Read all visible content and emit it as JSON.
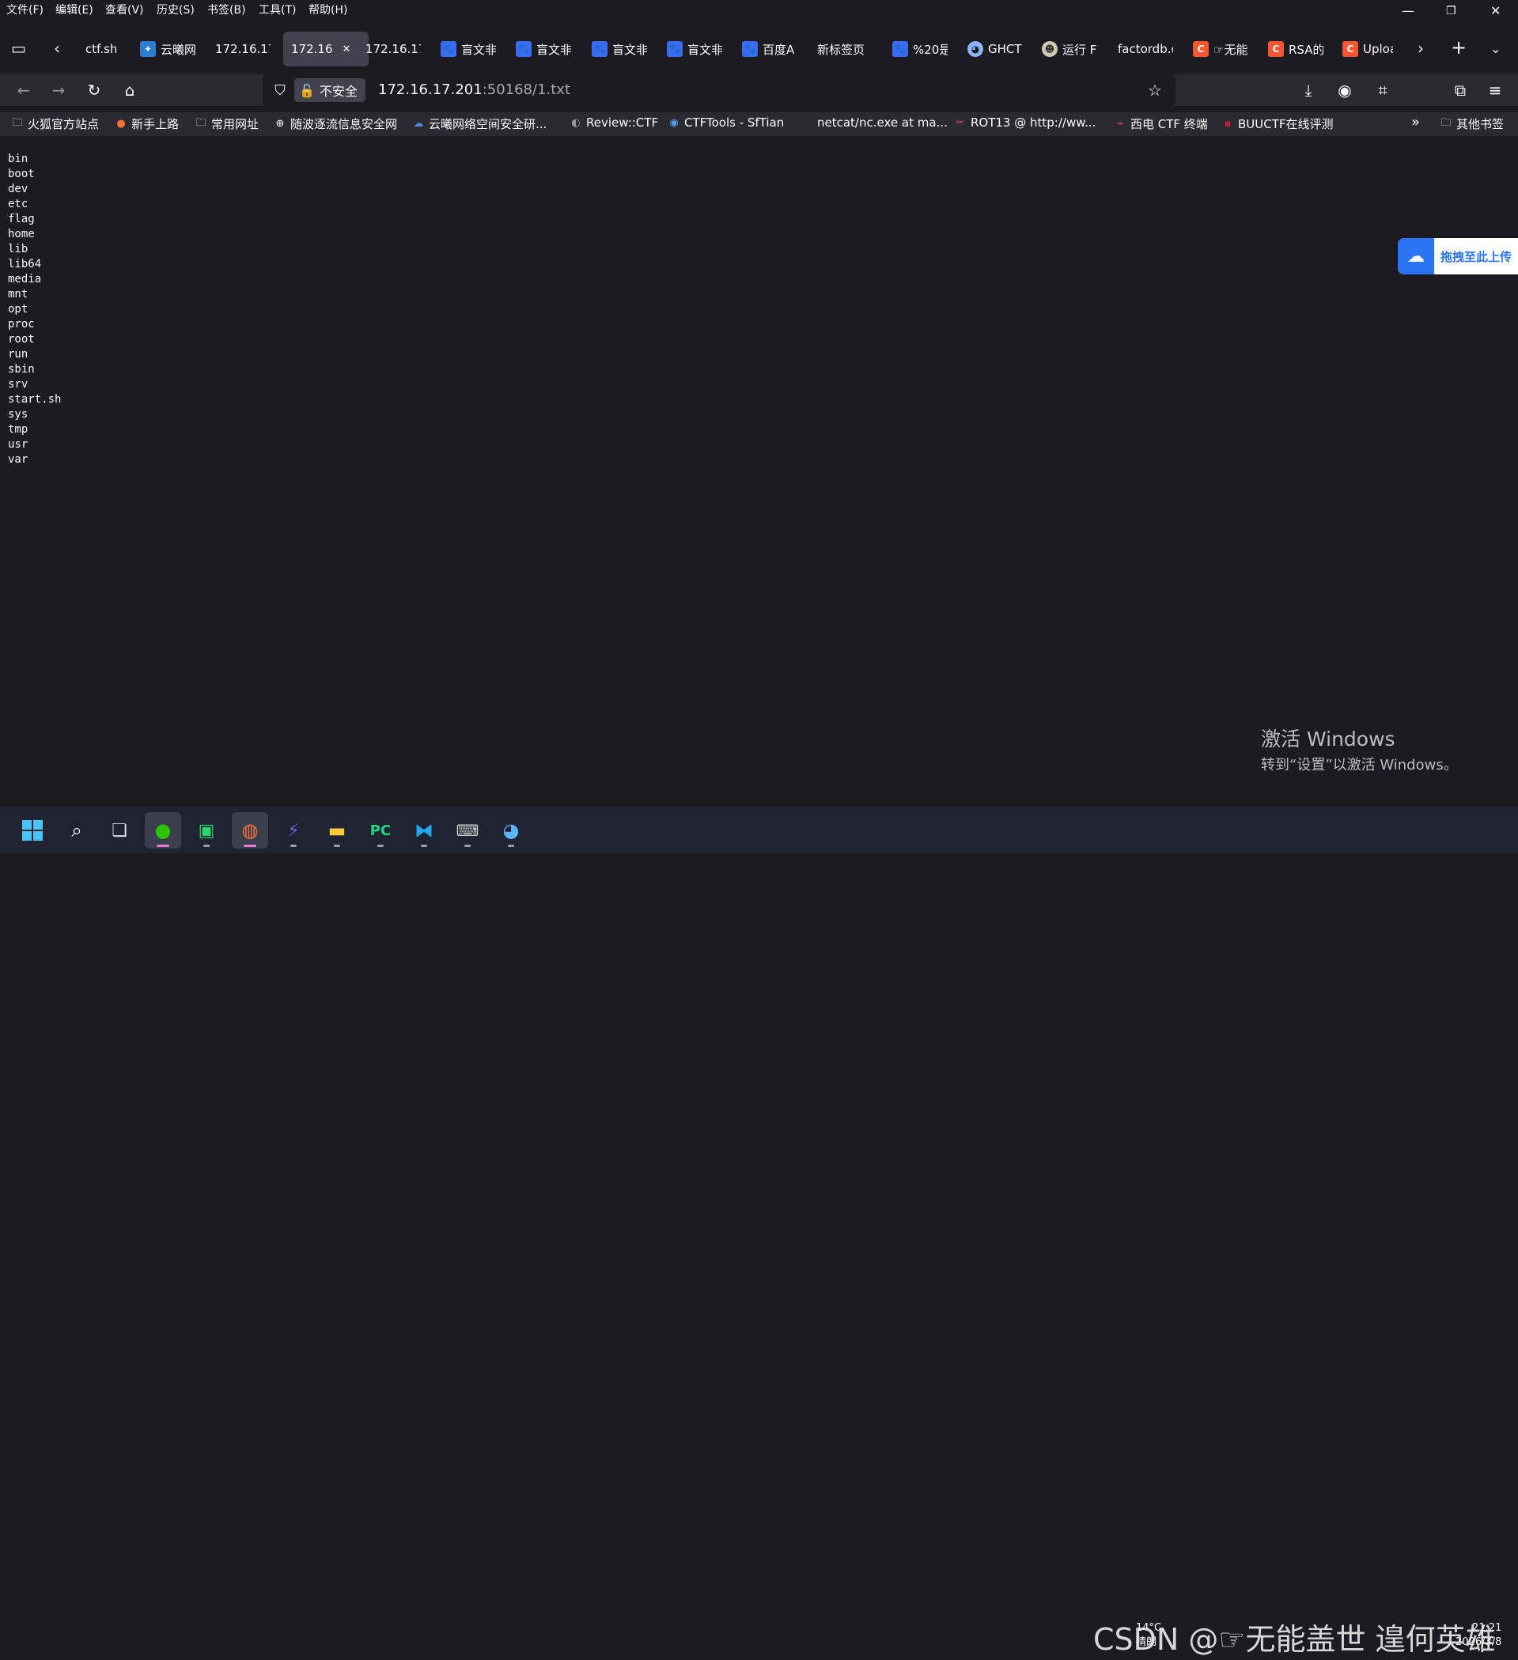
{
  "menubar": {
    "items": [
      "文件(F)",
      "编辑(E)",
      "查看(V)",
      "历史(S)",
      "书签(B)",
      "工具(T)",
      "帮助(H)"
    ]
  },
  "tabs": [
    {
      "label": "ctf.sh",
      "icon": "none",
      "active": false
    },
    {
      "label": "云曦网",
      "icon": "cloud",
      "active": false
    },
    {
      "label": "172.16.17",
      "icon": "none",
      "active": false
    },
    {
      "label": "172.16",
      "icon": "none",
      "active": true
    },
    {
      "label": "172.16.17",
      "icon": "none",
      "active": false
    },
    {
      "label": "盲文非",
      "icon": "baidu",
      "active": false
    },
    {
      "label": "盲文非",
      "icon": "baidu",
      "active": false
    },
    {
      "label": "盲文非",
      "icon": "baidu",
      "active": false
    },
    {
      "label": "盲文非",
      "icon": "baidu",
      "active": false
    },
    {
      "label": "百度A",
      "icon": "baidu",
      "active": false
    },
    {
      "label": "新标签页",
      "icon": "none",
      "active": false
    },
    {
      "label": "%20是",
      "icon": "baidu",
      "active": false
    },
    {
      "label": "GHCT",
      "icon": "gh",
      "active": false
    },
    {
      "label": "运行 F",
      "icon": "run",
      "active": false
    },
    {
      "label": "factordb.c",
      "icon": "none",
      "active": false
    },
    {
      "label": "☞无能",
      "icon": "csdn",
      "active": false
    },
    {
      "label": "RSA的",
      "icon": "csdn",
      "active": false
    },
    {
      "label": "Uploa",
      "icon": "csdn",
      "active": false
    }
  ],
  "urlbar": {
    "security_label": "不安全",
    "host": "172.16.17.201",
    "rest": ":50168/1.txt"
  },
  "bookmarks": [
    {
      "label": "火狐官方站点",
      "icon": "folder"
    },
    {
      "label": "新手上路",
      "icon": "firefox"
    },
    {
      "label": "常用网址",
      "icon": "folder"
    },
    {
      "label": "随波逐流信息安全网",
      "icon": "globe"
    },
    {
      "label": "云曦网络空间安全研...",
      "icon": "cloud"
    },
    {
      "label": "Review::CTF",
      "icon": "review"
    },
    {
      "label": "CTFTools - SfTian",
      "icon": "ctftools"
    },
    {
      "label": "netcat/nc.exe at ma...",
      "icon": "github"
    },
    {
      "label": "ROT13 @ http://ww...",
      "icon": "rot13"
    },
    {
      "label": "西电 CTF 终端",
      "icon": "xidian"
    },
    {
      "label": "BUUCTF在线评测",
      "icon": "buu"
    }
  ],
  "bookmarks_other": "其他书签",
  "file_listing": [
    "bin",
    "boot",
    "dev",
    "etc",
    "flag",
    "home",
    "lib",
    "lib64",
    "media",
    "mnt",
    "opt",
    "proc",
    "root",
    "run",
    "sbin",
    "srv",
    "start.sh",
    "sys",
    "tmp",
    "usr",
    "var"
  ],
  "upload_widget": "拖拽至此上传",
  "activation": {
    "line1": "激活 Windows",
    "line2": "转到“设置”以激活 Windows。"
  },
  "taskbar": {
    "watermark": "CSDN @☞无能盖世 遑何英雄",
    "weather_temp": "14°C",
    "weather_desc": "晴朗",
    "time": "21:21",
    "date": "2026/3/8"
  },
  "colors": {
    "page_bg": "#1c1b22",
    "toolbar_bg": "#2b2a33",
    "active_tab": "#42414d",
    "taskbar_bg": "#1e2432",
    "upload_blue": "#2a74f5"
  }
}
